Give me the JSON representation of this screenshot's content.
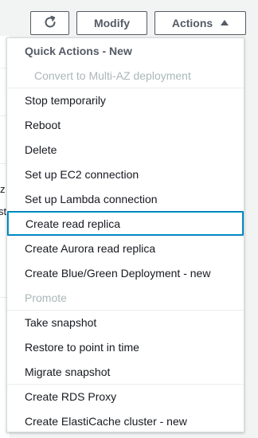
{
  "toolbar": {
    "refresh_icon": "refresh-icon",
    "modify_label": "Modify",
    "actions_label": "Actions",
    "actions_caret_icon": "caret-up-icon"
  },
  "background": {
    "frag_1": "z",
    "frag_2": "st"
  },
  "menu": {
    "group_header": "Quick Actions - New",
    "items": [
      {
        "label": "Convert to Multi-AZ deployment",
        "disabled": true
      },
      {
        "label": "Stop temporarily",
        "disabled": false
      },
      {
        "label": "Reboot",
        "disabled": false
      },
      {
        "label": "Delete",
        "disabled": false
      },
      {
        "label": "Set up EC2 connection",
        "disabled": false
      },
      {
        "label": "Set up Lambda connection",
        "disabled": false
      },
      {
        "label": "Create read replica",
        "disabled": false,
        "active": true
      },
      {
        "label": "Create Aurora read replica",
        "disabled": false
      },
      {
        "label": "Create Blue/Green Deployment - new",
        "disabled": false
      },
      {
        "label": "Promote",
        "disabled": true
      },
      {
        "label": "Take snapshot",
        "disabled": false
      },
      {
        "label": "Restore to point in time",
        "disabled": false
      },
      {
        "label": "Migrate snapshot",
        "disabled": false
      },
      {
        "label": "Create RDS Proxy",
        "disabled": false
      },
      {
        "label": "Create ElastiCache cluster - new",
        "disabled": false
      }
    ]
  },
  "colors": {
    "active_border": "#0073bb",
    "disabled_text": "#aab7b8",
    "button_border": "#545b64"
  }
}
